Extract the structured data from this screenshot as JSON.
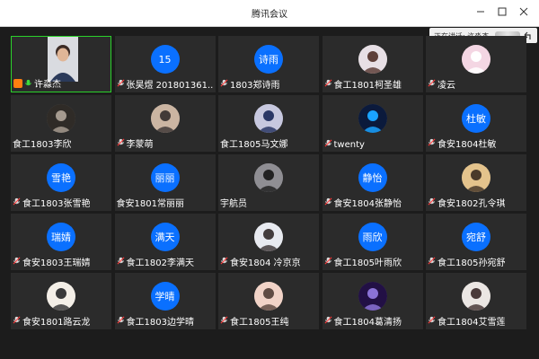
{
  "window": {
    "title": "腾讯会议"
  },
  "speaking": {
    "label": "正在讲话: 许淼杰"
  },
  "tiles": [
    {
      "name": "许淼杰",
      "type": "video"
    },
    {
      "name": "张昊煜 201801361...",
      "type": "text",
      "avatar": "15"
    },
    {
      "name": "1803郑诗雨",
      "type": "text",
      "avatar": "诗雨"
    },
    {
      "name": "食工1801柯圣雄",
      "type": "img",
      "colors": [
        "#e7dfe5",
        "#5e3f39"
      ]
    },
    {
      "name": "凌云",
      "type": "img",
      "colors": [
        "#f4d6e3",
        "#ffffff"
      ]
    },
    {
      "name": "食工1803李欣",
      "type": "img",
      "colors": [
        "#2f2b27",
        "#a59a8f"
      ],
      "nomic": true
    },
    {
      "name": "李蒙萌",
      "type": "img",
      "colors": [
        "#cbb5a2",
        "#423a38"
      ]
    },
    {
      "name": "食工1805马文娜",
      "type": "img",
      "colors": [
        "#c7c8df",
        "#2a3766"
      ],
      "nomic": true
    },
    {
      "name": "twenty",
      "type": "img",
      "colors": [
        "#0b1a3c",
        "#1aa3ff"
      ]
    },
    {
      "name": "食安1804杜敏",
      "type": "text",
      "avatar": "杜敏"
    },
    {
      "name": "食工1803张雪艳",
      "type": "text",
      "avatar": "雪艳"
    },
    {
      "name": "食安1801常丽丽",
      "type": "text",
      "avatar": "丽丽",
      "nomic": true
    },
    {
      "name": "宇航员",
      "type": "img",
      "colors": [
        "#8f8e93",
        "#222222"
      ],
      "nomic": true
    },
    {
      "name": "食安1804张静怡",
      "type": "text",
      "avatar": "静怡"
    },
    {
      "name": "食安1802孔令琪",
      "type": "img",
      "colors": [
        "#e4c38c",
        "#4a3a2a"
      ]
    },
    {
      "name": "食安1803王瑞婧",
      "type": "text",
      "avatar": "瑞婧"
    },
    {
      "name": "食工1802李满天",
      "type": "text",
      "avatar": "满天"
    },
    {
      "name": "食安1804 冷京京",
      "type": "img",
      "colors": [
        "#e8eaf0",
        "#433c3d"
      ]
    },
    {
      "name": "食工1805叶雨欣",
      "type": "text",
      "avatar": "雨欣"
    },
    {
      "name": "食工1805孙宛舒",
      "type": "text",
      "avatar": "宛舒"
    },
    {
      "name": "食安1801路云龙",
      "type": "img",
      "colors": [
        "#f4efe7",
        "#3a3a3a"
      ]
    },
    {
      "name": "食工1803边学晴",
      "type": "text",
      "avatar": "学晴"
    },
    {
      "name": "食工1805王纯",
      "type": "img",
      "colors": [
        "#f1d3c7",
        "#604b43"
      ]
    },
    {
      "name": "食工1804葛清扬",
      "type": "img",
      "colors": [
        "#221045",
        "#8b73d7"
      ]
    },
    {
      "name": "食工1804艾雪莲",
      "type": "img",
      "colors": [
        "#ebe6e3",
        "#4a3a3a"
      ]
    }
  ]
}
